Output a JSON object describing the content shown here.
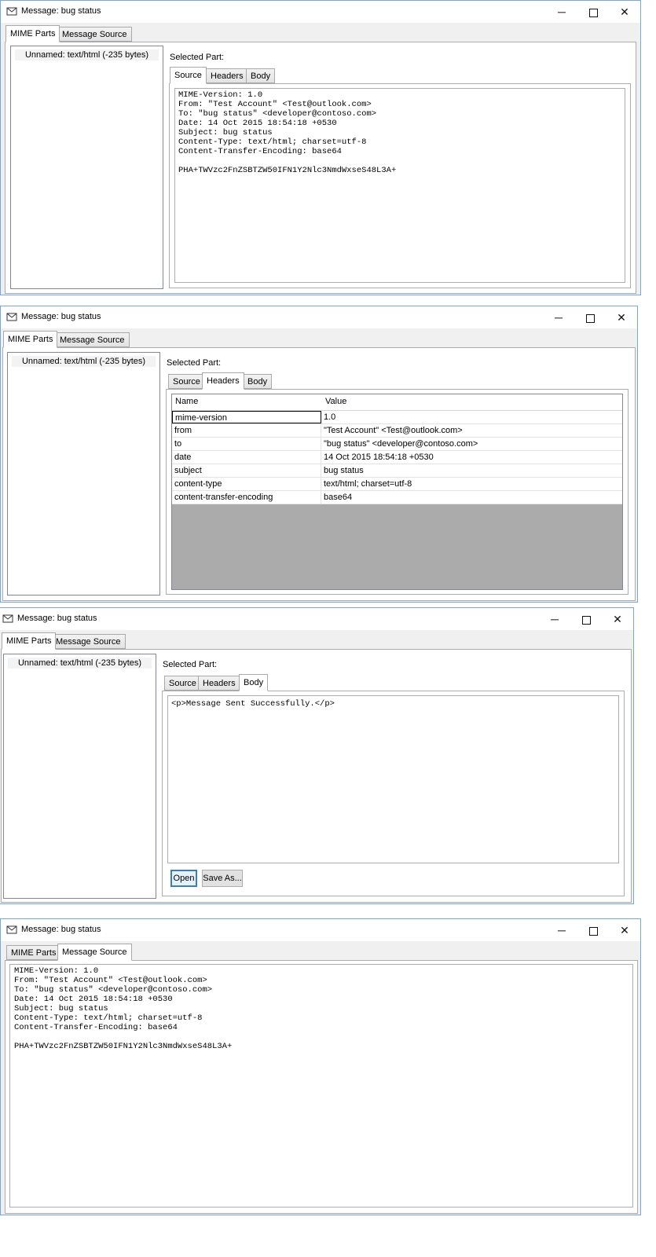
{
  "window_title": "Message: bug status",
  "caption": {
    "minimize": "─",
    "close": "✕"
  },
  "tabs": {
    "mime_parts": "MIME Parts",
    "message_source": "Message Source"
  },
  "part_tabs": {
    "source": "Source",
    "headers": "Headers",
    "body": "Body"
  },
  "parts_list": [
    "Unnamed: text/html (-235 bytes)"
  ],
  "selected_part_label": "Selected Part:",
  "source_text": "MIME-Version: 1.0\nFrom: \"Test Account\" <Test@outlook.com>\nTo: \"bug status\" <developer@contoso.com>\nDate: 14 Oct 2015 18:54:18 +0530\nSubject: bug status\nContent-Type: text/html; charset=utf-8\nContent-Transfer-Encoding: base64\n\nPHA+TWVzc2FnZSBTZW50IFN1Y2Nlc3NmdWxseS48L3A+",
  "headers_grid": {
    "columns": [
      "Name",
      "Value"
    ],
    "rows": [
      [
        "mime-version",
        "1.0"
      ],
      [
        "from",
        "\"Test Account\" <Test@outlook.com>"
      ],
      [
        "to",
        "\"bug status\" <developer@contoso.com>"
      ],
      [
        "date",
        "14 Oct 2015 18:54:18 +0530"
      ],
      [
        "subject",
        "bug status"
      ],
      [
        "content-type",
        "text/html; charset=utf-8"
      ],
      [
        "content-transfer-encoding",
        "base64"
      ]
    ]
  },
  "body_text": "<p>Message Sent Successfully.</p>",
  "buttons": {
    "open": "Open",
    "save_as": "Save As..."
  }
}
